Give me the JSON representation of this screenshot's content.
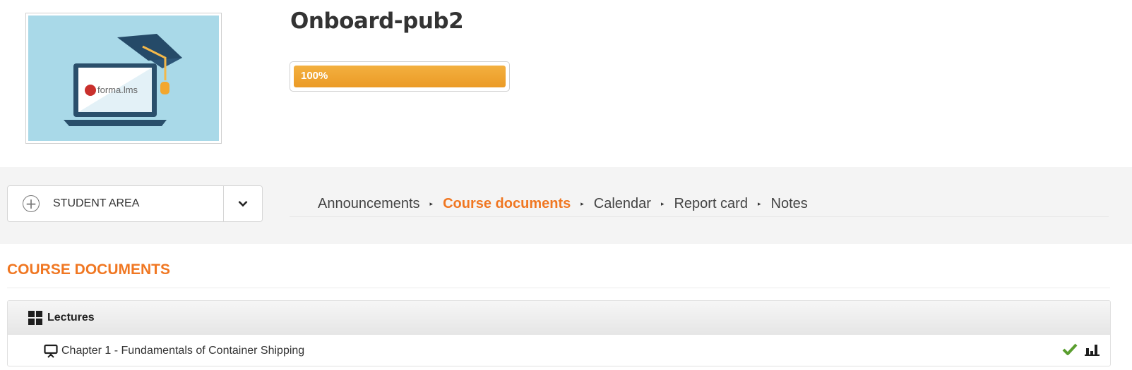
{
  "course": {
    "title": "Onboard-pub2",
    "logo_text": "forma.lms",
    "progress_label": "100%",
    "progress_fraction": 1.0,
    "progress_color": "#eb9a25"
  },
  "area_selector": {
    "label": "STUDENT AREA"
  },
  "tabs": [
    {
      "label": "Announcements",
      "active": false
    },
    {
      "label": "Course documents",
      "active": true
    },
    {
      "label": "Calendar",
      "active": false
    },
    {
      "label": "Report card",
      "active": false
    },
    {
      "label": "Notes",
      "active": false
    }
  ],
  "section": {
    "title": "COURSE DOCUMENTS"
  },
  "documents": {
    "folder_label": "Lectures",
    "items": [
      {
        "label": "Chapter 1 - Fundamentals of Container Shipping",
        "status": "completed"
      }
    ]
  },
  "colors": {
    "accent": "#f07722",
    "check": "#5a9e2f",
    "thumb_bg": "#a9d9e8"
  }
}
